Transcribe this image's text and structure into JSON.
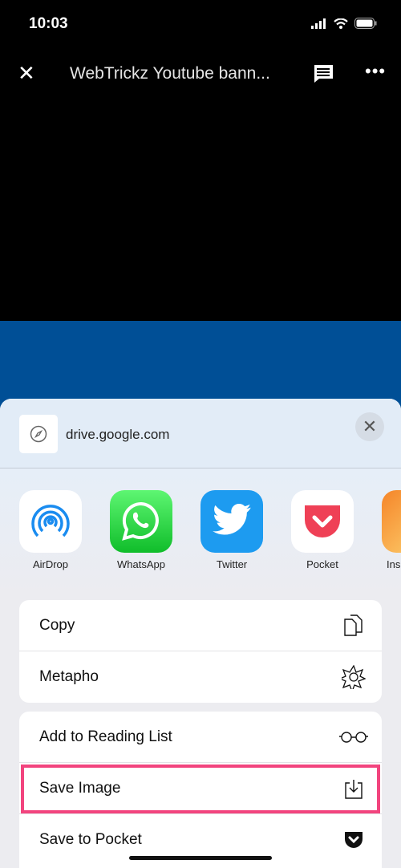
{
  "status": {
    "time": "10:03"
  },
  "topbar": {
    "title": "WebTrickz Youtube bann...",
    "close_icon": "close-icon",
    "comment_icon": "comment-icon",
    "more_icon": "more-icon"
  },
  "colors": {
    "banner": "#004f96",
    "highlight": "#f2447e"
  },
  "share": {
    "domain": "drive.google.com",
    "apps": [
      {
        "label": "AirDrop"
      },
      {
        "label": "WhatsApp"
      },
      {
        "label": "Twitter"
      },
      {
        "label": "Pocket"
      },
      {
        "label": "Ins"
      }
    ],
    "group1": [
      {
        "label": "Copy",
        "icon": "copy-icon"
      },
      {
        "label": "Metapho",
        "icon": "metapho-icon"
      }
    ],
    "group2": [
      {
        "label": "Add to Reading List",
        "icon": "glasses-icon"
      },
      {
        "label": "Save Image",
        "icon": "save-image-icon",
        "highlighted": true
      },
      {
        "label": "Save to Pocket",
        "icon": "pocket-icon"
      }
    ]
  }
}
